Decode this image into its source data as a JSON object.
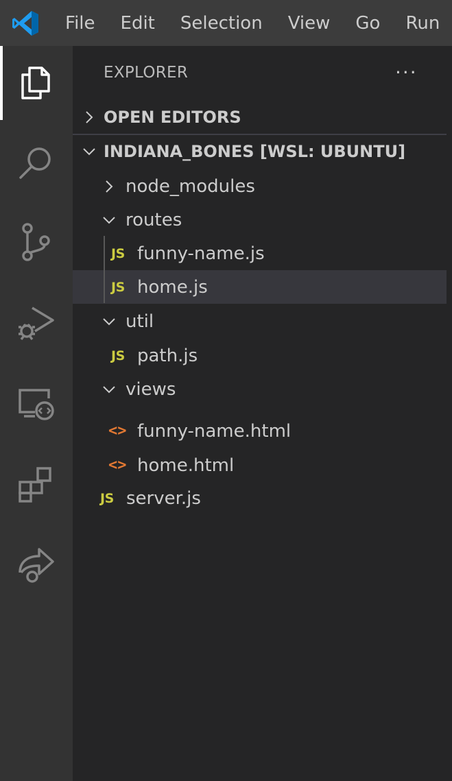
{
  "menu": {
    "items": [
      "File",
      "Edit",
      "Selection",
      "View",
      "Go",
      "Run"
    ]
  },
  "activity_bar": {
    "icons": [
      "explorer-icon",
      "search-icon",
      "source-control-icon",
      "run-debug-icon",
      "remote-explorer-icon",
      "extensions-icon",
      "live-share-icon"
    ],
    "active": "explorer-icon"
  },
  "explorer": {
    "title": "EXPLORER",
    "more": "···",
    "open_editors": "OPEN EDITORS",
    "workspace": "INDIANA_BONES [WSL: UBUNTU]",
    "tree": [
      {
        "label": "node_modules",
        "type": "folder",
        "expanded": false
      },
      {
        "label": "routes",
        "type": "folder",
        "expanded": true
      },
      {
        "label": "funny-name.js",
        "type": "js"
      },
      {
        "label": "home.js",
        "type": "js",
        "selected": true
      },
      {
        "label": "util",
        "type": "folder",
        "expanded": true
      },
      {
        "label": "path.js",
        "type": "js"
      },
      {
        "label": "views",
        "type": "folder",
        "expanded": true
      },
      {
        "label": "funny-name.html",
        "type": "html"
      },
      {
        "label": "home.html",
        "type": "html"
      },
      {
        "label": "server.js",
        "type": "js"
      }
    ],
    "js_icon_text": "JS",
    "html_icon_text": "<>"
  },
  "colors": {
    "accent": "#0078d4",
    "js": "#cbcb41",
    "html": "#e37933",
    "selected_row": "#37373d"
  }
}
